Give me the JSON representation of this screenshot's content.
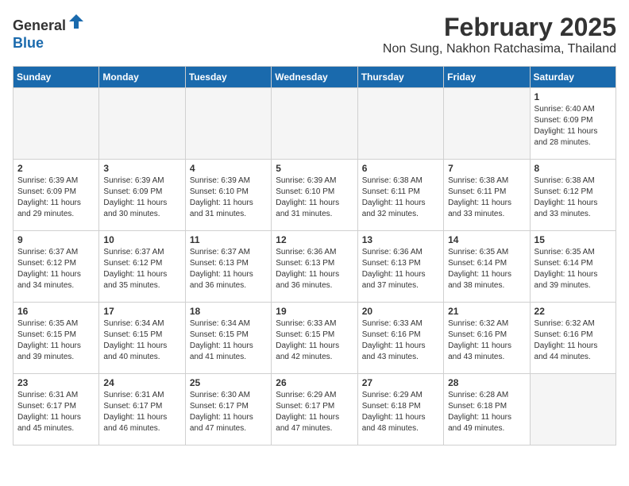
{
  "header": {
    "logo_line1": "General",
    "logo_line2": "Blue",
    "main_title": "February 2025",
    "subtitle": "Non Sung, Nakhon Ratchasima, Thailand"
  },
  "days_of_week": [
    "Sunday",
    "Monday",
    "Tuesday",
    "Wednesday",
    "Thursday",
    "Friday",
    "Saturday"
  ],
  "weeks": [
    [
      {
        "day": "",
        "info": ""
      },
      {
        "day": "",
        "info": ""
      },
      {
        "day": "",
        "info": ""
      },
      {
        "day": "",
        "info": ""
      },
      {
        "day": "",
        "info": ""
      },
      {
        "day": "",
        "info": ""
      },
      {
        "day": "1",
        "info": "Sunrise: 6:40 AM\nSunset: 6:09 PM\nDaylight: 11 hours and 28 minutes."
      }
    ],
    [
      {
        "day": "2",
        "info": "Sunrise: 6:39 AM\nSunset: 6:09 PM\nDaylight: 11 hours and 29 minutes."
      },
      {
        "day": "3",
        "info": "Sunrise: 6:39 AM\nSunset: 6:09 PM\nDaylight: 11 hours and 30 minutes."
      },
      {
        "day": "4",
        "info": "Sunrise: 6:39 AM\nSunset: 6:10 PM\nDaylight: 11 hours and 31 minutes."
      },
      {
        "day": "5",
        "info": "Sunrise: 6:39 AM\nSunset: 6:10 PM\nDaylight: 11 hours and 31 minutes."
      },
      {
        "day": "6",
        "info": "Sunrise: 6:38 AM\nSunset: 6:11 PM\nDaylight: 11 hours and 32 minutes."
      },
      {
        "day": "7",
        "info": "Sunrise: 6:38 AM\nSunset: 6:11 PM\nDaylight: 11 hours and 33 minutes."
      },
      {
        "day": "8",
        "info": "Sunrise: 6:38 AM\nSunset: 6:12 PM\nDaylight: 11 hours and 33 minutes."
      }
    ],
    [
      {
        "day": "9",
        "info": "Sunrise: 6:37 AM\nSunset: 6:12 PM\nDaylight: 11 hours and 34 minutes."
      },
      {
        "day": "10",
        "info": "Sunrise: 6:37 AM\nSunset: 6:12 PM\nDaylight: 11 hours and 35 minutes."
      },
      {
        "day": "11",
        "info": "Sunrise: 6:37 AM\nSunset: 6:13 PM\nDaylight: 11 hours and 36 minutes."
      },
      {
        "day": "12",
        "info": "Sunrise: 6:36 AM\nSunset: 6:13 PM\nDaylight: 11 hours and 36 minutes."
      },
      {
        "day": "13",
        "info": "Sunrise: 6:36 AM\nSunset: 6:13 PM\nDaylight: 11 hours and 37 minutes."
      },
      {
        "day": "14",
        "info": "Sunrise: 6:35 AM\nSunset: 6:14 PM\nDaylight: 11 hours and 38 minutes."
      },
      {
        "day": "15",
        "info": "Sunrise: 6:35 AM\nSunset: 6:14 PM\nDaylight: 11 hours and 39 minutes."
      }
    ],
    [
      {
        "day": "16",
        "info": "Sunrise: 6:35 AM\nSunset: 6:15 PM\nDaylight: 11 hours and 39 minutes."
      },
      {
        "day": "17",
        "info": "Sunrise: 6:34 AM\nSunset: 6:15 PM\nDaylight: 11 hours and 40 minutes."
      },
      {
        "day": "18",
        "info": "Sunrise: 6:34 AM\nSunset: 6:15 PM\nDaylight: 11 hours and 41 minutes."
      },
      {
        "day": "19",
        "info": "Sunrise: 6:33 AM\nSunset: 6:15 PM\nDaylight: 11 hours and 42 minutes."
      },
      {
        "day": "20",
        "info": "Sunrise: 6:33 AM\nSunset: 6:16 PM\nDaylight: 11 hours and 43 minutes."
      },
      {
        "day": "21",
        "info": "Sunrise: 6:32 AM\nSunset: 6:16 PM\nDaylight: 11 hours and 43 minutes."
      },
      {
        "day": "22",
        "info": "Sunrise: 6:32 AM\nSunset: 6:16 PM\nDaylight: 11 hours and 44 minutes."
      }
    ],
    [
      {
        "day": "23",
        "info": "Sunrise: 6:31 AM\nSunset: 6:17 PM\nDaylight: 11 hours and 45 minutes."
      },
      {
        "day": "24",
        "info": "Sunrise: 6:31 AM\nSunset: 6:17 PM\nDaylight: 11 hours and 46 minutes."
      },
      {
        "day": "25",
        "info": "Sunrise: 6:30 AM\nSunset: 6:17 PM\nDaylight: 11 hours and 47 minutes."
      },
      {
        "day": "26",
        "info": "Sunrise: 6:29 AM\nSunset: 6:17 PM\nDaylight: 11 hours and 47 minutes."
      },
      {
        "day": "27",
        "info": "Sunrise: 6:29 AM\nSunset: 6:18 PM\nDaylight: 11 hours and 48 minutes."
      },
      {
        "day": "28",
        "info": "Sunrise: 6:28 AM\nSunset: 6:18 PM\nDaylight: 11 hours and 49 minutes."
      },
      {
        "day": "",
        "info": ""
      }
    ]
  ]
}
